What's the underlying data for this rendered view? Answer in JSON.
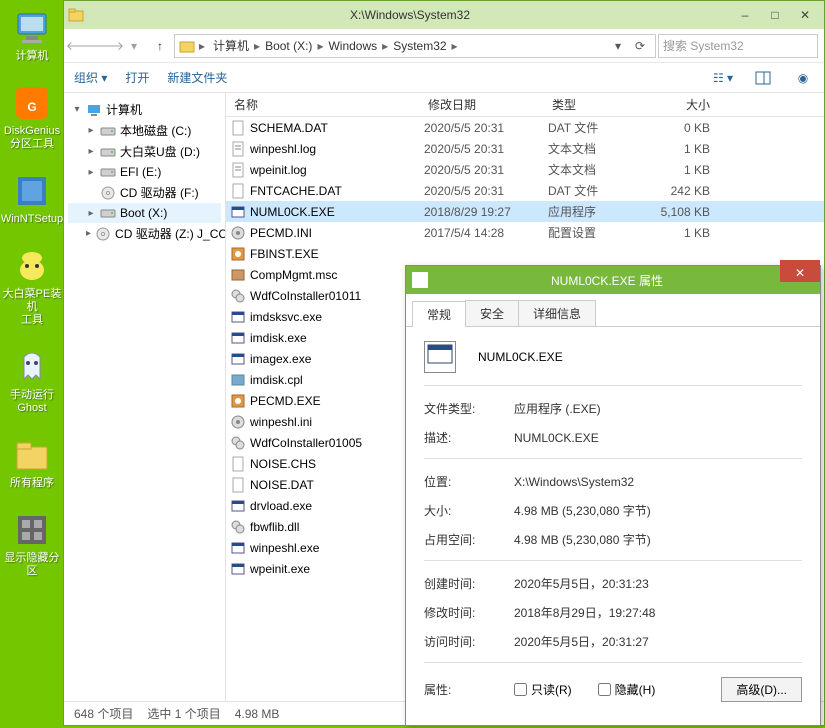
{
  "desktop": [
    {
      "label": "计算机",
      "icon": "computer"
    },
    {
      "label": "DiskGenius\n分区工具",
      "icon": "dg"
    },
    {
      "label": "WinNTSetup",
      "icon": "wns"
    },
    {
      "label": "大白菜PE装机\n工具",
      "icon": "dbcpe"
    },
    {
      "label": "手动运行\nGhost",
      "icon": "ghost"
    },
    {
      "label": "所有程序",
      "icon": "folder"
    },
    {
      "label": "显示隐藏分区",
      "icon": "grid"
    }
  ],
  "window": {
    "title": "X:\\Windows\\System32",
    "searchPlaceholder": "搜索 System32"
  },
  "breadcrumbs": [
    "计算机",
    "Boot (X:)",
    "Windows",
    "System32"
  ],
  "cmdbar": {
    "org": "组织",
    "open": "打开",
    "new": "新建文件夹"
  },
  "tree": [
    {
      "label": "计算机",
      "icon": "computer",
      "level": 1,
      "toggle": "▾"
    },
    {
      "label": "本地磁盘 (C:)",
      "icon": "drive",
      "level": 2,
      "toggle": "▸"
    },
    {
      "label": "大白菜U盘 (D:)",
      "icon": "drive",
      "level": 2,
      "toggle": "▸"
    },
    {
      "label": "EFI (E:)",
      "icon": "drive",
      "level": 2,
      "toggle": "▸"
    },
    {
      "label": "CD 驱动器 (F:)",
      "icon": "cd",
      "level": 2,
      "toggle": ""
    },
    {
      "label": "Boot (X:)",
      "icon": "drive",
      "level": 2,
      "toggle": "▸",
      "sel": true
    },
    {
      "label": "CD 驱动器 (Z:) J_CC",
      "icon": "cd",
      "level": 2,
      "toggle": "▸"
    }
  ],
  "columns": {
    "name": "名称",
    "date": "修改日期",
    "type": "类型",
    "size": "大小"
  },
  "files": [
    {
      "name": "SCHEMA.DAT",
      "date": "2020/5/5 20:31",
      "type": "DAT 文件",
      "size": "0 KB",
      "icon": "file"
    },
    {
      "name": "winpeshl.log",
      "date": "2020/5/5 20:31",
      "type": "文本文档",
      "size": "1 KB",
      "icon": "txt"
    },
    {
      "name": "wpeinit.log",
      "date": "2020/5/5 20:31",
      "type": "文本文档",
      "size": "1 KB",
      "icon": "txt"
    },
    {
      "name": "FNTCACHE.DAT",
      "date": "2020/5/5 20:31",
      "type": "DAT 文件",
      "size": "242 KB",
      "icon": "file"
    },
    {
      "name": "NUML0CK.EXE",
      "date": "2018/8/29 19:27",
      "type": "应用程序",
      "size": "5,108 KB",
      "icon": "exe",
      "sel": true
    },
    {
      "name": "PECMD.INI",
      "date": "2017/5/4 14:28",
      "type": "配置设置",
      "size": "1 KB",
      "icon": "ini"
    },
    {
      "name": "FBINST.EXE",
      "date": "",
      "type": "",
      "size": "",
      "icon": "exe2"
    },
    {
      "name": "CompMgmt.msc",
      "date": "",
      "type": "",
      "size": "",
      "icon": "msc"
    },
    {
      "name": "WdfCoInstaller01011",
      "date": "",
      "type": "",
      "size": "",
      "icon": "dll"
    },
    {
      "name": "imdsksvc.exe",
      "date": "",
      "type": "",
      "size": "",
      "icon": "exe"
    },
    {
      "name": "imdisk.exe",
      "date": "",
      "type": "",
      "size": "",
      "icon": "exe"
    },
    {
      "name": "imagex.exe",
      "date": "",
      "type": "",
      "size": "",
      "icon": "exe"
    },
    {
      "name": "imdisk.cpl",
      "date": "",
      "type": "",
      "size": "",
      "icon": "cpl"
    },
    {
      "name": "PECMD.EXE",
      "date": "",
      "type": "",
      "size": "",
      "icon": "exe2"
    },
    {
      "name": "winpeshl.ini",
      "date": "",
      "type": "",
      "size": "",
      "icon": "ini"
    },
    {
      "name": "WdfCoInstaller01005",
      "date": "",
      "type": "",
      "size": "",
      "icon": "dll"
    },
    {
      "name": "NOISE.CHS",
      "date": "",
      "type": "",
      "size": "",
      "icon": "file"
    },
    {
      "name": "NOISE.DAT",
      "date": "",
      "type": "",
      "size": "",
      "icon": "file"
    },
    {
      "name": "drvload.exe",
      "date": "",
      "type": "",
      "size": "",
      "icon": "exe"
    },
    {
      "name": "fbwflib.dll",
      "date": "",
      "type": "",
      "size": "",
      "icon": "dll"
    },
    {
      "name": "winpeshl.exe",
      "date": "",
      "type": "",
      "size": "",
      "icon": "exe"
    },
    {
      "name": "wpeinit.exe",
      "date": "",
      "type": "",
      "size": "",
      "icon": "exe"
    }
  ],
  "status": {
    "count": "648 个项目",
    "sel": "选中 1 个项目",
    "size": "4.98 MB"
  },
  "props": {
    "title": "NUML0CK.EXE 属性",
    "tabs": [
      "常规",
      "安全",
      "详细信息"
    ],
    "filename": "NUML0CK.EXE",
    "rows": [
      {
        "l": "文件类型:",
        "v": "应用程序 (.EXE)"
      },
      {
        "l": "描述:",
        "v": "NUML0CK.EXE"
      }
    ],
    "rows2": [
      {
        "l": "位置:",
        "v": "X:\\Windows\\System32"
      },
      {
        "l": "大小:",
        "v": "4.98 MB (5,230,080 字节)"
      },
      {
        "l": "占用空间:",
        "v": "4.98 MB (5,230,080 字节)"
      }
    ],
    "rows3": [
      {
        "l": "创建时间:",
        "v": "2020年5月5日，20:31:23"
      },
      {
        "l": "修改时间:",
        "v": "2018年8月29日，19:27:48"
      },
      {
        "l": "访问时间:",
        "v": "2020年5月5日，20:31:27"
      }
    ],
    "attr": "属性:",
    "readonly": "只读(R)",
    "hidden": "隐藏(H)",
    "advanced": "高级(D)..."
  }
}
